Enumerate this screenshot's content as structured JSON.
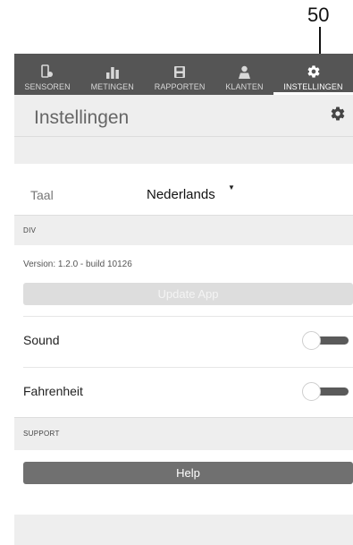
{
  "callout": {
    "number": "50"
  },
  "tabs": [
    {
      "label": "SENSOREN",
      "icon": "sensor-icon"
    },
    {
      "label": "METINGEN",
      "icon": "bar-chart-icon"
    },
    {
      "label": "RAPPORTEN",
      "icon": "save-report-icon"
    },
    {
      "label": "KLANTEN",
      "icon": "person-icon"
    },
    {
      "label": "INSTELLINGEN",
      "icon": "gear-icon",
      "active": true
    }
  ],
  "header": {
    "title": "Instellingen",
    "icon": "gear-icon"
  },
  "language": {
    "label": "Taal",
    "value": "Nederlands"
  },
  "sections": {
    "div": "DIV",
    "support": "SUPPORT"
  },
  "version": {
    "text": "Version: 1.2.0 - build 10126"
  },
  "buttons": {
    "update": "Update App",
    "help": "Help"
  },
  "settings": {
    "sound": {
      "label": "Sound",
      "on": false
    },
    "fahrenheit": {
      "label": "Fahrenheit",
      "on": false
    }
  },
  "colors": {
    "tabbar": "#555555",
    "panel": "#eeeeee",
    "help_button": "#707070"
  }
}
